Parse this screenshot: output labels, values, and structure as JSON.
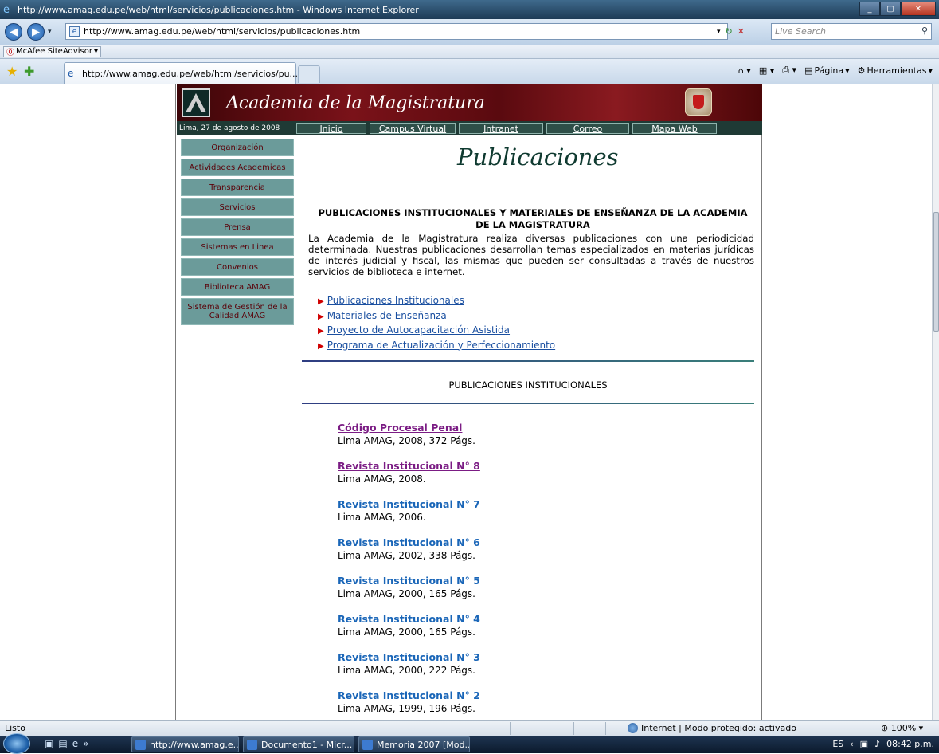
{
  "window": {
    "title": "http://www.amag.edu.pe/web/html/servicios/publicaciones.htm - Windows Internet Explorer",
    "address": "http://www.amag.edu.pe/web/html/servicios/publicaciones.htm",
    "search_placeholder": "Live Search",
    "tab_title": "http://www.amag.edu.pe/web/html/servicios/pu...",
    "mcafee_label": "McAfee SiteAdvisor",
    "cmd_pagina": "Página",
    "cmd_herramientas": "Herramientas"
  },
  "site": {
    "name": "Academia de la Magistratura",
    "date": "Lima, 27 de agosto de 2008",
    "nav": [
      "Inicio",
      "Campus Virtual",
      "Intranet",
      "Correo",
      "Mapa Web"
    ]
  },
  "sidebar": {
    "items": [
      "Organización",
      "Actividades Academicas",
      "Transparencia",
      "Servicios",
      "Prensa",
      "Sistemas en Linea",
      "Convenios",
      "Biblioteca AMAG",
      "Sistema de Gestión de la Calidad AMAG"
    ]
  },
  "main": {
    "page_title": "Publicaciones",
    "heading": "PUBLICACIONES INSTITUCIONALES Y MATERIALES DE ENSEÑANZA DE LA ACADEMIA DE LA MAGISTRATURA",
    "intro": "La Academia de la Magistratura realiza diversas publicaciones con una periodicidad determinada. Nuestras publicaciones desarrollan temas especializados en materias jurídicas de interés judicial y fiscal, las mismas que pueden ser consultadas a través de nuestros servicios de biblioteca e internet.",
    "links": [
      "Publicaciones Institucionales",
      "Materiales de Enseñanza",
      "Proyecto de Autocapacitación Asistida",
      "Programa de Actualización y Perfeccionamiento"
    ],
    "section_title": "PUBLICACIONES INSTITUCIONALES",
    "publications": [
      {
        "title": "Código Procesal Penal",
        "meta": "Lima AMAG, 2008, 372 Págs."
      },
      {
        "title": "Revista Institucional N° 8",
        "meta": "Lima AMAG, 2008."
      },
      {
        "title": "Revista Institucional N° 7",
        "meta": "Lima AMAG, 2006."
      },
      {
        "title": "Revista Institucional N° 6",
        "meta": "Lima AMAG, 2002, 338 Págs."
      },
      {
        "title": "Revista Institucional N° 5",
        "meta": "Lima AMAG, 2000, 165 Págs."
      },
      {
        "title": "Revista Institucional N° 4",
        "meta": "Lima AMAG, 2000, 165 Págs."
      },
      {
        "title": "Revista Institucional N° 3",
        "meta": "Lima AMAG, 2000, 222 Págs."
      },
      {
        "title": "Revista Institucional N° 2",
        "meta": "Lima AMAG, 1999, 196 Págs."
      }
    ]
  },
  "statusbar": {
    "status": "Listo",
    "zone": "Internet | Modo protegido: activado",
    "zoom": "100%"
  },
  "taskbar": {
    "tasks": [
      "http://www.amag.e...",
      "Documento1 - Micr...",
      "Memoria 2007 [Mod..."
    ],
    "lang": "ES",
    "time": "08:42 p.m."
  }
}
